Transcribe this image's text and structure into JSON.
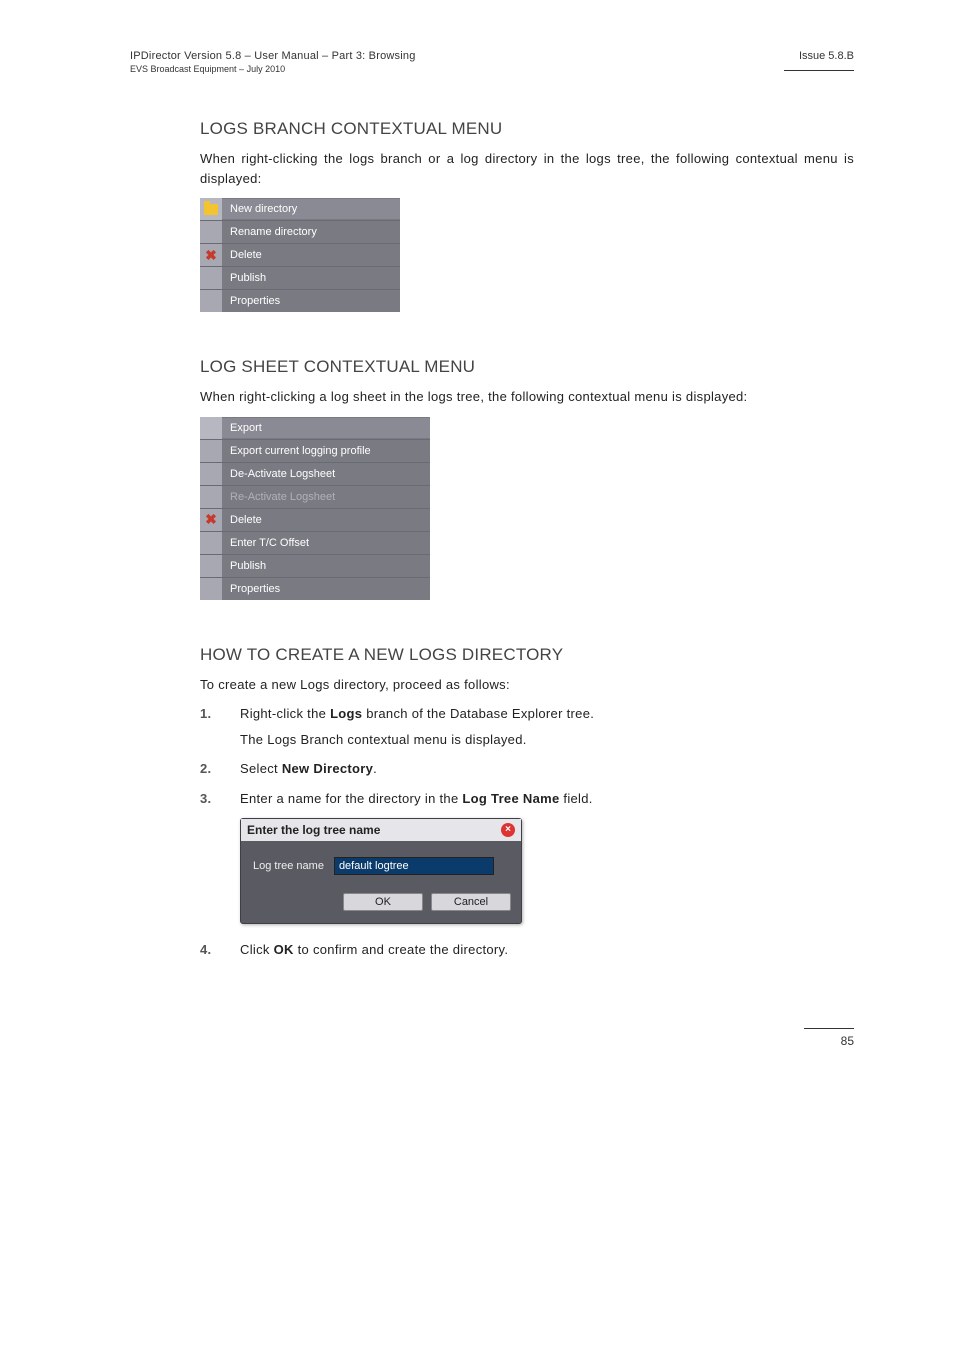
{
  "header": {
    "left_line1": "IPDirector Version 5.8 – User Manual – Part 3: Browsing",
    "left_line2": "EVS Broadcast Equipment – July 2010",
    "right": "Issue 5.8.B"
  },
  "sections": {
    "branch_menu_title": "LOGS BRANCH CONTEXTUAL MENU",
    "branch_menu_para": "When right-clicking the logs branch or a log directory in the logs tree, the following contextual menu is displayed:",
    "sheet_menu_title": "LOG SHEET CONTEXTUAL MENU",
    "sheet_menu_para": "When right-clicking a log sheet in the logs tree, the following contextual menu is displayed:",
    "how_title": "HOW TO CREATE A NEW LOGS DIRECTORY",
    "how_intro": "To create a new Logs directory, proceed as follows:"
  },
  "ctx_menu_branch": {
    "item1": "New directory",
    "item2": "Rename directory",
    "item3": "Delete",
    "item4": "Publish",
    "item5": "Properties"
  },
  "ctx_menu_sheet": {
    "item1": "Export",
    "item2": "Export current logging profile",
    "item3": "De-Activate Logsheet",
    "item4": "Re-Activate Logsheet",
    "item5": "Delete",
    "item6": "Enter T/C Offset",
    "item7": "Publish",
    "item8": "Properties"
  },
  "steps": {
    "s1_num": "1.",
    "s1_a": "Right-click the ",
    "s1_bold": "Logs",
    "s1_b": " branch of the Database Explorer tree.",
    "s1_c": "The Logs Branch contextual menu is displayed.",
    "s2_num": "2.",
    "s2_a": "Select ",
    "s2_bold": "New Directory",
    "s2_b": ".",
    "s3_num": "3.",
    "s3_a": "Enter a name for the directory in the ",
    "s3_bold": "Log Tree Name",
    "s3_b": " field.",
    "s4_num": "4.",
    "s4_a": "Click ",
    "s4_bold": "OK",
    "s4_b": " to confirm and create the directory."
  },
  "dialog": {
    "title": "Enter the log tree name",
    "label": "Log tree name",
    "value": "default logtree",
    "ok": "OK",
    "cancel": "Cancel"
  },
  "footer": {
    "page": "85"
  }
}
